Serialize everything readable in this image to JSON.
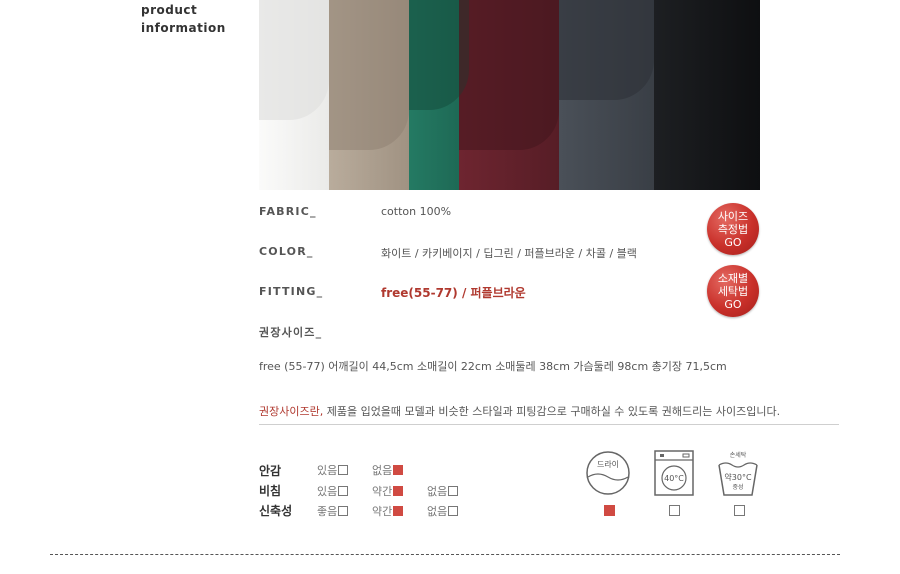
{
  "section": {
    "label_line1": "product",
    "label_line2": "information"
  },
  "photo": {
    "colors": [
      "#f2f2f0",
      "#a89a8a",
      "#1f6b57",
      "#5e1f26",
      "#3e444c",
      "#15171a"
    ]
  },
  "specs": {
    "fabric": {
      "label": "FABRIC_",
      "value": "cotton 100%"
    },
    "color": {
      "label": "COLOR_",
      "value": "화이트 / 카키베이지 / 딥그린 / 퍼플브라운 / 차콜 / 블랙"
    },
    "fitting": {
      "label": "FITTING_",
      "value": "free(55-77) / 퍼플브라운"
    },
    "recommended": {
      "label": "권장사이즈_"
    }
  },
  "buttons": {
    "size_guide": {
      "line1": "사이즈",
      "line2": "측정법",
      "line3": "GO"
    },
    "care_guide": {
      "line1": "소재별",
      "line2": "세탁법",
      "line3": "GO"
    }
  },
  "size_line": "free (55-77)  어깨길이 44,5cm  소매길이 22cm  소매둘레 38cm  가슴둘레 98cm  총기장 71,5cm",
  "note": {
    "highlight": "권장사이즈란,",
    "text": " 제품을 입었을때 모델과 비슷한 스타일과 피팅감으로 구매하실 수 있도록 권해드리는 사이즈입니다."
  },
  "attributes": [
    {
      "label": "안감",
      "options": [
        {
          "text": "있음",
          "checked": false
        },
        {
          "text": "없음",
          "checked": true
        }
      ]
    },
    {
      "label": "비침",
      "options": [
        {
          "text": "있음",
          "checked": false
        },
        {
          "text": "약간",
          "checked": true
        },
        {
          "text": "없음",
          "checked": false
        }
      ]
    },
    {
      "label": "신축성",
      "options": [
        {
          "text": "좋음",
          "checked": false
        },
        {
          "text": "약간",
          "checked": true
        },
        {
          "text": "없음",
          "checked": false
        }
      ]
    }
  ],
  "care": {
    "dry": {
      "text": "드라이",
      "checked": true
    },
    "machine": {
      "text": "40°C",
      "checked": false
    },
    "hand": {
      "top": "손세탁",
      "mid": "약30°C",
      "bottom": "중성",
      "checked": false
    }
  },
  "colors": {
    "accent": "#b0392f",
    "button": "#c9302a",
    "checked": "#d04a42"
  }
}
